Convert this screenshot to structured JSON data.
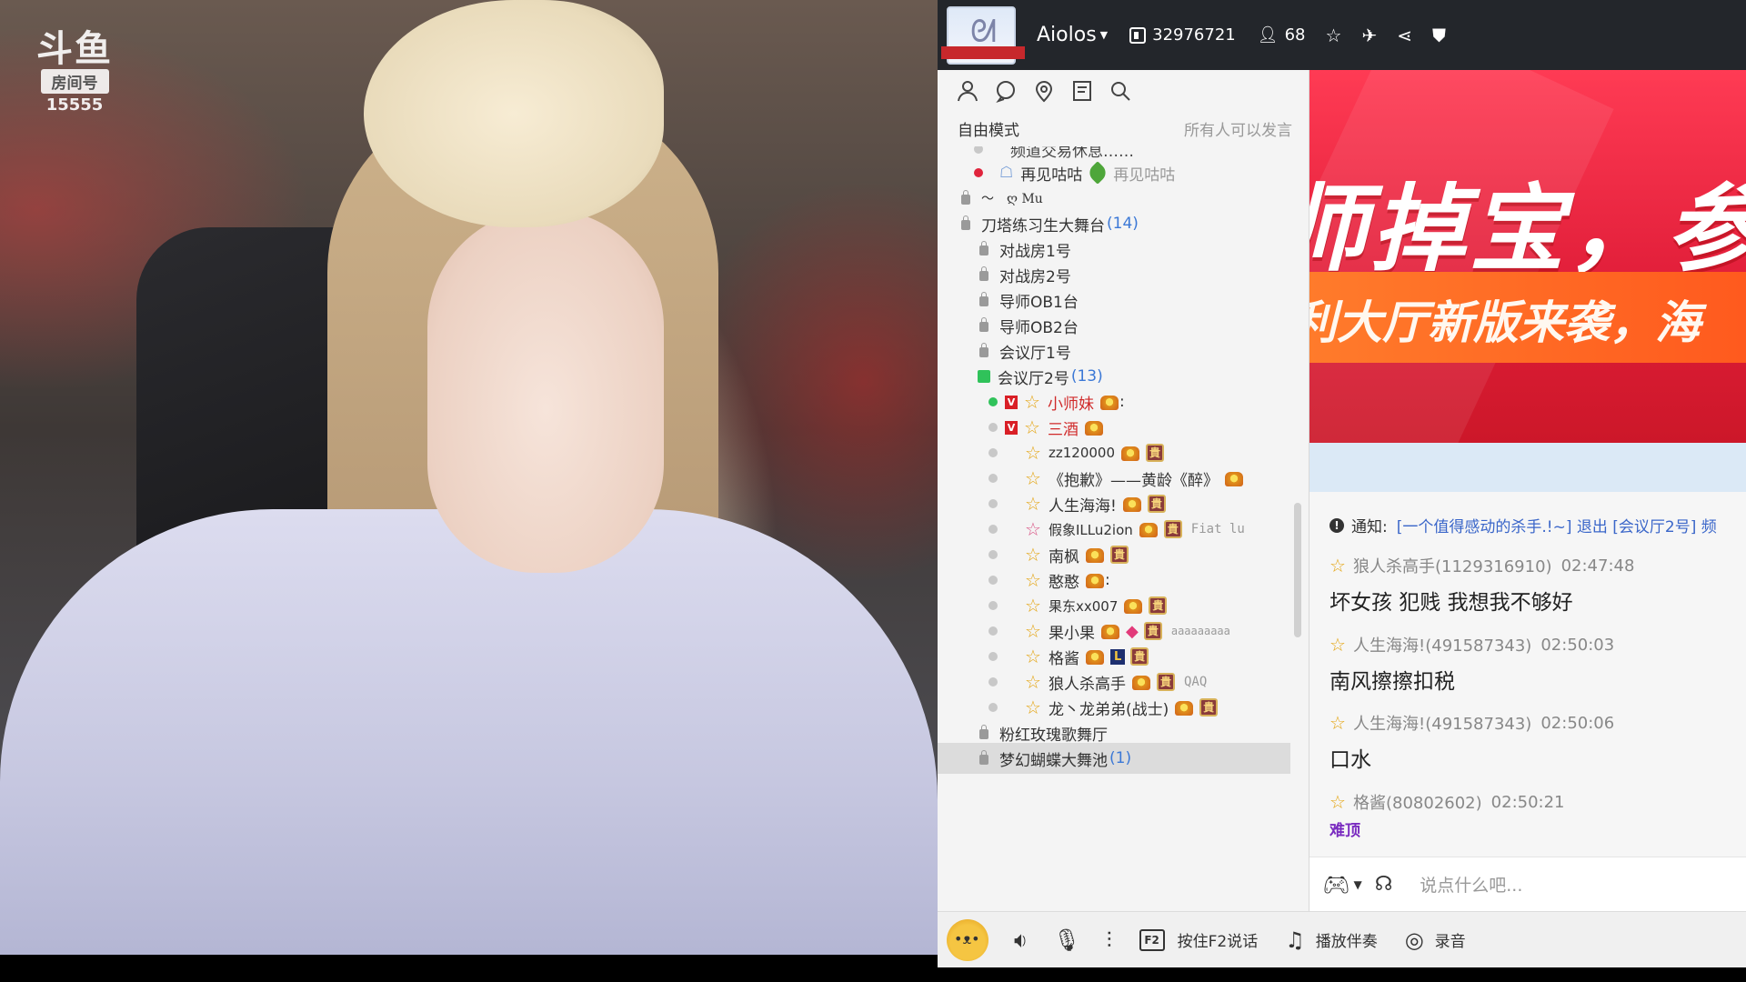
{
  "video": {
    "logo_text": "斗鱼",
    "room_label": "房间号",
    "room_number": "15555"
  },
  "topbar": {
    "channel_name": "Aiolos",
    "channel_id": "32976721",
    "online_count": "68",
    "icons": [
      "star-icon",
      "plane-icon",
      "share-icon",
      "shield-icon"
    ]
  },
  "channel_panel": {
    "tools": [
      "user-icon",
      "chat-icon",
      "location-icon",
      "notice-icon",
      "search-icon"
    ],
    "mode_left": "自由模式",
    "mode_right": "所有人可以发言",
    "top_partial": "频道交易休息……",
    "rows": [
      {
        "type": "user",
        "text": "再见咕咕",
        "extra": "再见咕咕"
      },
      {
        "type": "channel",
        "text": "～　ღ Mu"
      },
      {
        "type": "channel",
        "text": "刀塔练习生大舞台",
        "count": "(14)"
      },
      {
        "type": "sub",
        "text": "对战房1号"
      },
      {
        "type": "sub",
        "text": "对战房2号"
      },
      {
        "type": "sub",
        "text": "导师OB1台"
      },
      {
        "type": "sub",
        "text": "导师OB2台"
      },
      {
        "type": "sub",
        "text": "会议厅1号"
      },
      {
        "type": "sub-open",
        "text": "会议厅2号",
        "count": "(13)"
      },
      {
        "type": "member",
        "text": "小师妹",
        "red": true,
        "extra": ":"
      },
      {
        "type": "member",
        "text": "三酒",
        "red": true
      },
      {
        "type": "member",
        "text": "zz120000"
      },
      {
        "type": "member",
        "text": "《抱歉》——黄龄《醉》"
      },
      {
        "type": "member",
        "text": "人生海海!"
      },
      {
        "type": "member",
        "text": "假象ILLu2ion",
        "extra": "Fiat lu"
      },
      {
        "type": "member",
        "text": "南枫"
      },
      {
        "type": "member",
        "text": "憨憨",
        "extra": ":"
      },
      {
        "type": "member",
        "text": "果东xx007"
      },
      {
        "type": "member",
        "text": "果小果",
        "extra": "aaaaaaaaa"
      },
      {
        "type": "member",
        "text": "格酱"
      },
      {
        "type": "member",
        "text": "狼人杀高手",
        "extra": "QAQ"
      },
      {
        "type": "member",
        "text": "龙丶龙弟弟(战士)"
      },
      {
        "type": "sub",
        "text": "粉红玫瑰歌舞厅"
      },
      {
        "type": "sub-selected",
        "text": "梦幻蝴蝶大舞池",
        "count": "(1)"
      }
    ]
  },
  "chat_panel": {
    "banner_main": "师掉宝，参",
    "banner_sub": "利大厅新版来袭，海",
    "notice_label": "通知:",
    "notice_text": "[一个值得感动的杀手.!~] 退出 [会议厅2号] 频",
    "messages": [
      {
        "user": "狼人杀高手(1129316910)",
        "time": "02:47:48",
        "text": "坏女孩  犯贱  我想我不够好"
      },
      {
        "user": "人生海海!(491587343)",
        "time": "02:50:03",
        "text": "南风擦擦扣税"
      },
      {
        "user": "人生海海!(491587343)",
        "time": "02:50:06",
        "text": "口水"
      },
      {
        "user": "格酱(80802602)",
        "time": "02:50:21",
        "text": "难顶"
      }
    ],
    "input_placeholder": "说点什么吧..."
  },
  "bottombar": {
    "f2_key": "F2",
    "push_to_talk": "按住F2说话",
    "accompaniment": "播放伴奏",
    "record": "录音"
  },
  "colors": {
    "topbar_bg": "#23262b",
    "banner_red": "#e21f3a",
    "link_blue": "#3b78d6",
    "admin_red": "#d02a2a"
  }
}
